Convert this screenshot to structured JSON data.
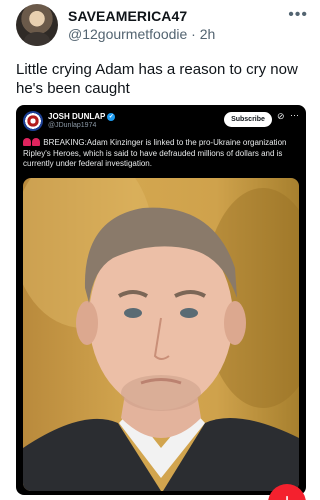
{
  "post": {
    "author_name": "SAVEAMERICA47",
    "author_meta": "@12gourmetfoodie · 2h",
    "text": "Little crying Adam has a reason to cry now he's been caught"
  },
  "embedded": {
    "author_name": "JOSH DUNLAP",
    "handle": "@JDunlap1974",
    "subscribe_label": "Subscribe",
    "text": "BREAKING:Adam Kinzinger is linked to the pro-Ukraine organization Ripley's Heroes, which is said to have defrauded millions of dollars and is currently under federal investigation."
  },
  "fab": {
    "label": "+"
  },
  "colors": {
    "accent": "#1d9bf0",
    "fab": "#f4212e",
    "card_bg": "#000000"
  }
}
